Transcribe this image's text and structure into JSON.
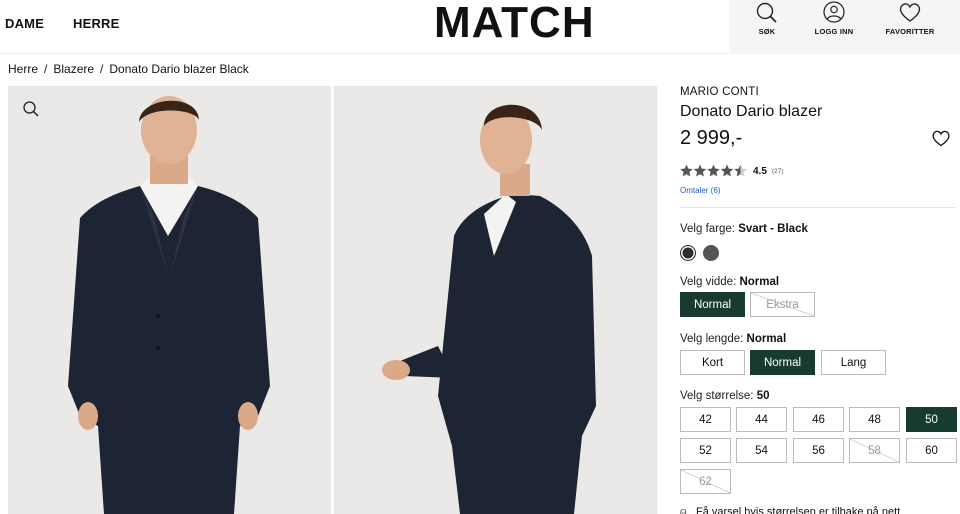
{
  "header": {
    "nav": [
      "DAME",
      "HERRE"
    ],
    "logo": "MATCH",
    "utility": [
      {
        "label": "SØK",
        "icon": "search-icon"
      },
      {
        "label": "LOGG INN",
        "icon": "user-icon"
      },
      {
        "label": "FAVORITTER",
        "icon": "heart-icon"
      }
    ]
  },
  "breadcrumb": [
    "Herre",
    "Blazere",
    "Donato Dario blazer Black"
  ],
  "product": {
    "brand": "MARIO CONTI",
    "name": "Donato Dario blazer",
    "price": "2 999,-",
    "rating": "4.5",
    "rating_count": "(27)",
    "rating_stars": 4.5,
    "reviews_link": "Omtaler (6)"
  },
  "options": {
    "color": {
      "label": "Velg farge:",
      "value": "Svart - Black",
      "swatches": [
        "#2d2d2d",
        "#555555"
      ]
    },
    "width": {
      "label": "Velg vidde:",
      "value": "Normal",
      "choices": [
        "Normal",
        "Ekstra"
      ]
    },
    "length": {
      "label": "Velg lengde:",
      "value": "Normal",
      "choices": [
        "Kort",
        "Normal",
        "Lang"
      ]
    },
    "size": {
      "label": "Velg størrelse:",
      "value": "50",
      "choices": [
        "42",
        "44",
        "46",
        "48",
        "50",
        "52",
        "54",
        "56",
        "58",
        "60",
        "62"
      ]
    }
  },
  "size_note": "Få varsel hvis størrelsen er tilbake på nett",
  "colors": {
    "accent": "#173b30",
    "link": "#1b5fc2"
  }
}
